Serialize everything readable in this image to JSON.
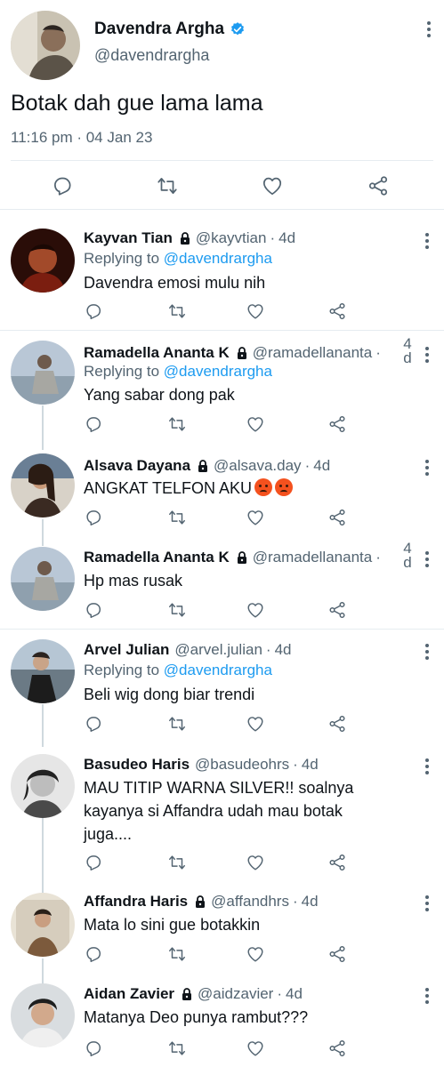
{
  "main_tweet": {
    "author_name": "Davendra Argha",
    "author_handle": "@davendrargha",
    "verified": true,
    "text": "Botak dah gue lama lama",
    "timestamp": "11:16 pm · 04 Jan 23",
    "actions": [
      "reply-icon",
      "retweet-icon",
      "like-icon",
      "share-icon"
    ]
  },
  "colors": {
    "text": "#0f1419",
    "muted": "#536471",
    "accent": "#1d9bf0",
    "divider": "#e6ecf0",
    "thread_line": "#cfd9de"
  },
  "replies": [
    {
      "name": "Kayvan Tian",
      "locked": true,
      "handle": "@kayvtian",
      "separator": "·",
      "age": "4d",
      "replying_prefix": "Replying to",
      "replying_to": "@davendrargha",
      "text": "Davendra emosi mulu nih"
    },
    {
      "name": "Ramadella Ananta K",
      "locked": true,
      "handle": "@ramadellananta",
      "separator": "·",
      "age_top": "4",
      "age_bottom": "d",
      "replying_prefix": "Replying to",
      "replying_to": "@davendrargha",
      "text": "Yang sabar dong pak"
    },
    {
      "name": "Alsava Dayana",
      "locked": true,
      "handle": "@alsava.day",
      "separator": "·",
      "age": "4d",
      "text": "ANGKAT TELFON AKU",
      "emoji": "angry-face-emoji"
    },
    {
      "name": "Ramadella Ananta K",
      "locked": true,
      "handle": "@ramadellananta",
      "separator": "·",
      "age_top": "4",
      "age_bottom": "d",
      "text": "Hp mas rusak"
    },
    {
      "name": "Arvel Julian",
      "locked": false,
      "handle": "@arvel.julian",
      "separator": "·",
      "age": "4d",
      "replying_prefix": "Replying to",
      "replying_to": "@davendrargha",
      "text": "Beli wig dong biar trendi"
    },
    {
      "name": "Basudeo Haris",
      "locked": false,
      "handle": "@basudeohrs",
      "separator": "·",
      "age": "4d",
      "text_lines": [
        "MAU TITIP WARNA SILVER!! soalnya",
        "kayanya si Affandra udah mau botak",
        "juga...."
      ]
    },
    {
      "name": "Affandra Haris",
      "locked": true,
      "handle": "@affandhrs",
      "separator": "·",
      "age": "4d",
      "text": "Mata lo sini gue botakkin"
    },
    {
      "name": "Aidan Zavier",
      "locked": true,
      "handle": "@aidzavier",
      "separator": "·",
      "age": "4d",
      "text": "Matanya Deo punya rambut???"
    }
  ]
}
